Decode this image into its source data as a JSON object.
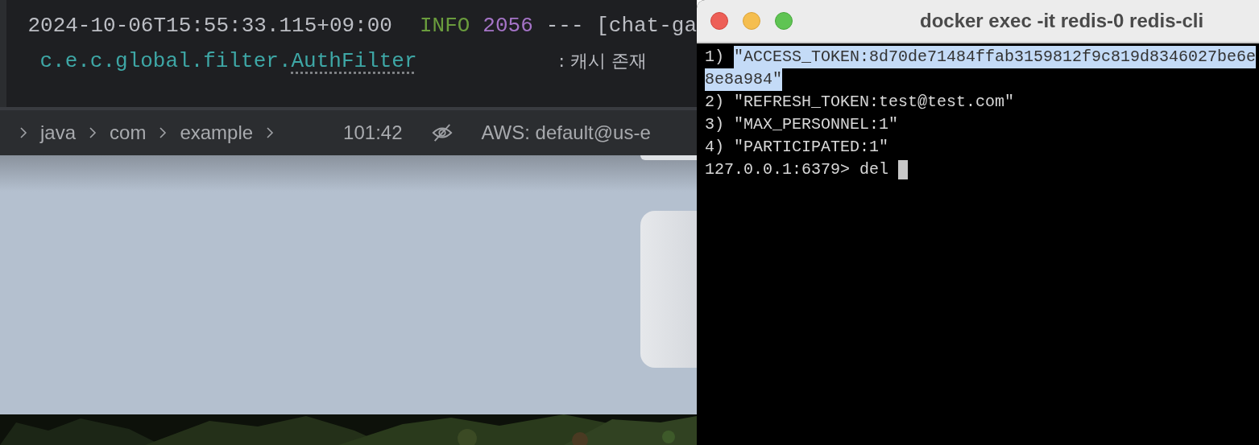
{
  "console": {
    "lines": [
      {
        "segments": [
          {
            "kind": "timestamp",
            "text": "2024-10-06T15:55:33.115+09:00"
          },
          {
            "kind": "level",
            "text": "INFO"
          },
          {
            "kind": "pid",
            "text": "2056"
          },
          {
            "kind": "plain",
            "text": "--- [chat-ga"
          }
        ]
      },
      {
        "segments": [
          {
            "kind": "logger",
            "text": "c.e.c.global.filter.",
            "underlined": false
          },
          {
            "kind": "logger",
            "text": "AuthFilter",
            "underlined": true
          },
          {
            "kind": "message",
            "text": ": 캐시 존재"
          }
        ]
      }
    ]
  },
  "breadcrumb": {
    "items": [
      "java",
      "com",
      "example"
    ],
    "cursor_position": "101:42",
    "aws_profile": "AWS: default@us-e"
  },
  "terminal": {
    "title": "docker exec -it redis-0 redis-cli",
    "lines": [
      {
        "segments": [
          {
            "text": "1) ",
            "selected": false
          },
          {
            "text": "\"ACCESS_TOKEN:8d70de71484ffab3159812f9c819d8346027be6e",
            "selected": true
          }
        ]
      },
      {
        "segments": [
          {
            "text": "8e8a984\"",
            "selected": true
          }
        ]
      },
      {
        "segments": [
          {
            "text": "2) \"REFRESH_TOKEN:test@test.com\"",
            "selected": false
          }
        ]
      },
      {
        "segments": [
          {
            "text": "3) \"MAX_PERSONNEL:1\"",
            "selected": false
          }
        ]
      },
      {
        "segments": [
          {
            "text": "4) \"PARTICIPATED:1\"",
            "selected": false
          }
        ]
      },
      {
        "segments": [
          {
            "text": "127.0.0.1:6379> del ",
            "selected": false
          }
        ],
        "cursor": true
      }
    ]
  }
}
